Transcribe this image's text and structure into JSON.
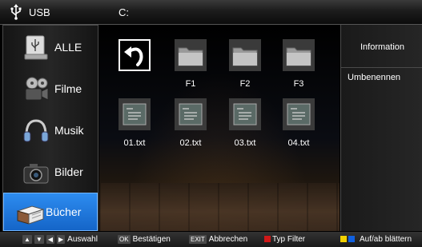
{
  "topbar": {
    "source_label": "USB",
    "path": "C:"
  },
  "sidebar": {
    "items": [
      {
        "label": "ALLE",
        "icon": "usb-drive-icon"
      },
      {
        "label": "Filme",
        "icon": "film-reel-icon"
      },
      {
        "label": "Musik",
        "icon": "headphones-icon"
      },
      {
        "label": "Bilder",
        "icon": "camera-icon"
      },
      {
        "label": "Bücher",
        "icon": "books-icon",
        "active": true
      }
    ]
  },
  "browser": {
    "back_icon": "back-arrow-icon",
    "folders": [
      {
        "name": "F1"
      },
      {
        "name": "F2"
      },
      {
        "name": "F3"
      }
    ],
    "files": [
      {
        "name": "01.txt"
      },
      {
        "name": "02.txt"
      },
      {
        "name": "03.txt"
      },
      {
        "name": "04.txt"
      }
    ]
  },
  "right_panel": {
    "info_label": "Information",
    "rename_label": "Umbenennen"
  },
  "help_bar": {
    "select_label": "Auswahl",
    "ok_key": "OK",
    "confirm_label": "Bestätigen",
    "exit_key": "EXIT",
    "cancel_label": "Abbrechen",
    "filter_label": "Typ Filter",
    "page_label": "Auf/ab blättern"
  },
  "colors": {
    "active_blue": "#1f7ae0",
    "red_key": "#d01818",
    "yellow_key": "#f0d000",
    "blue_key": "#1060e0"
  }
}
